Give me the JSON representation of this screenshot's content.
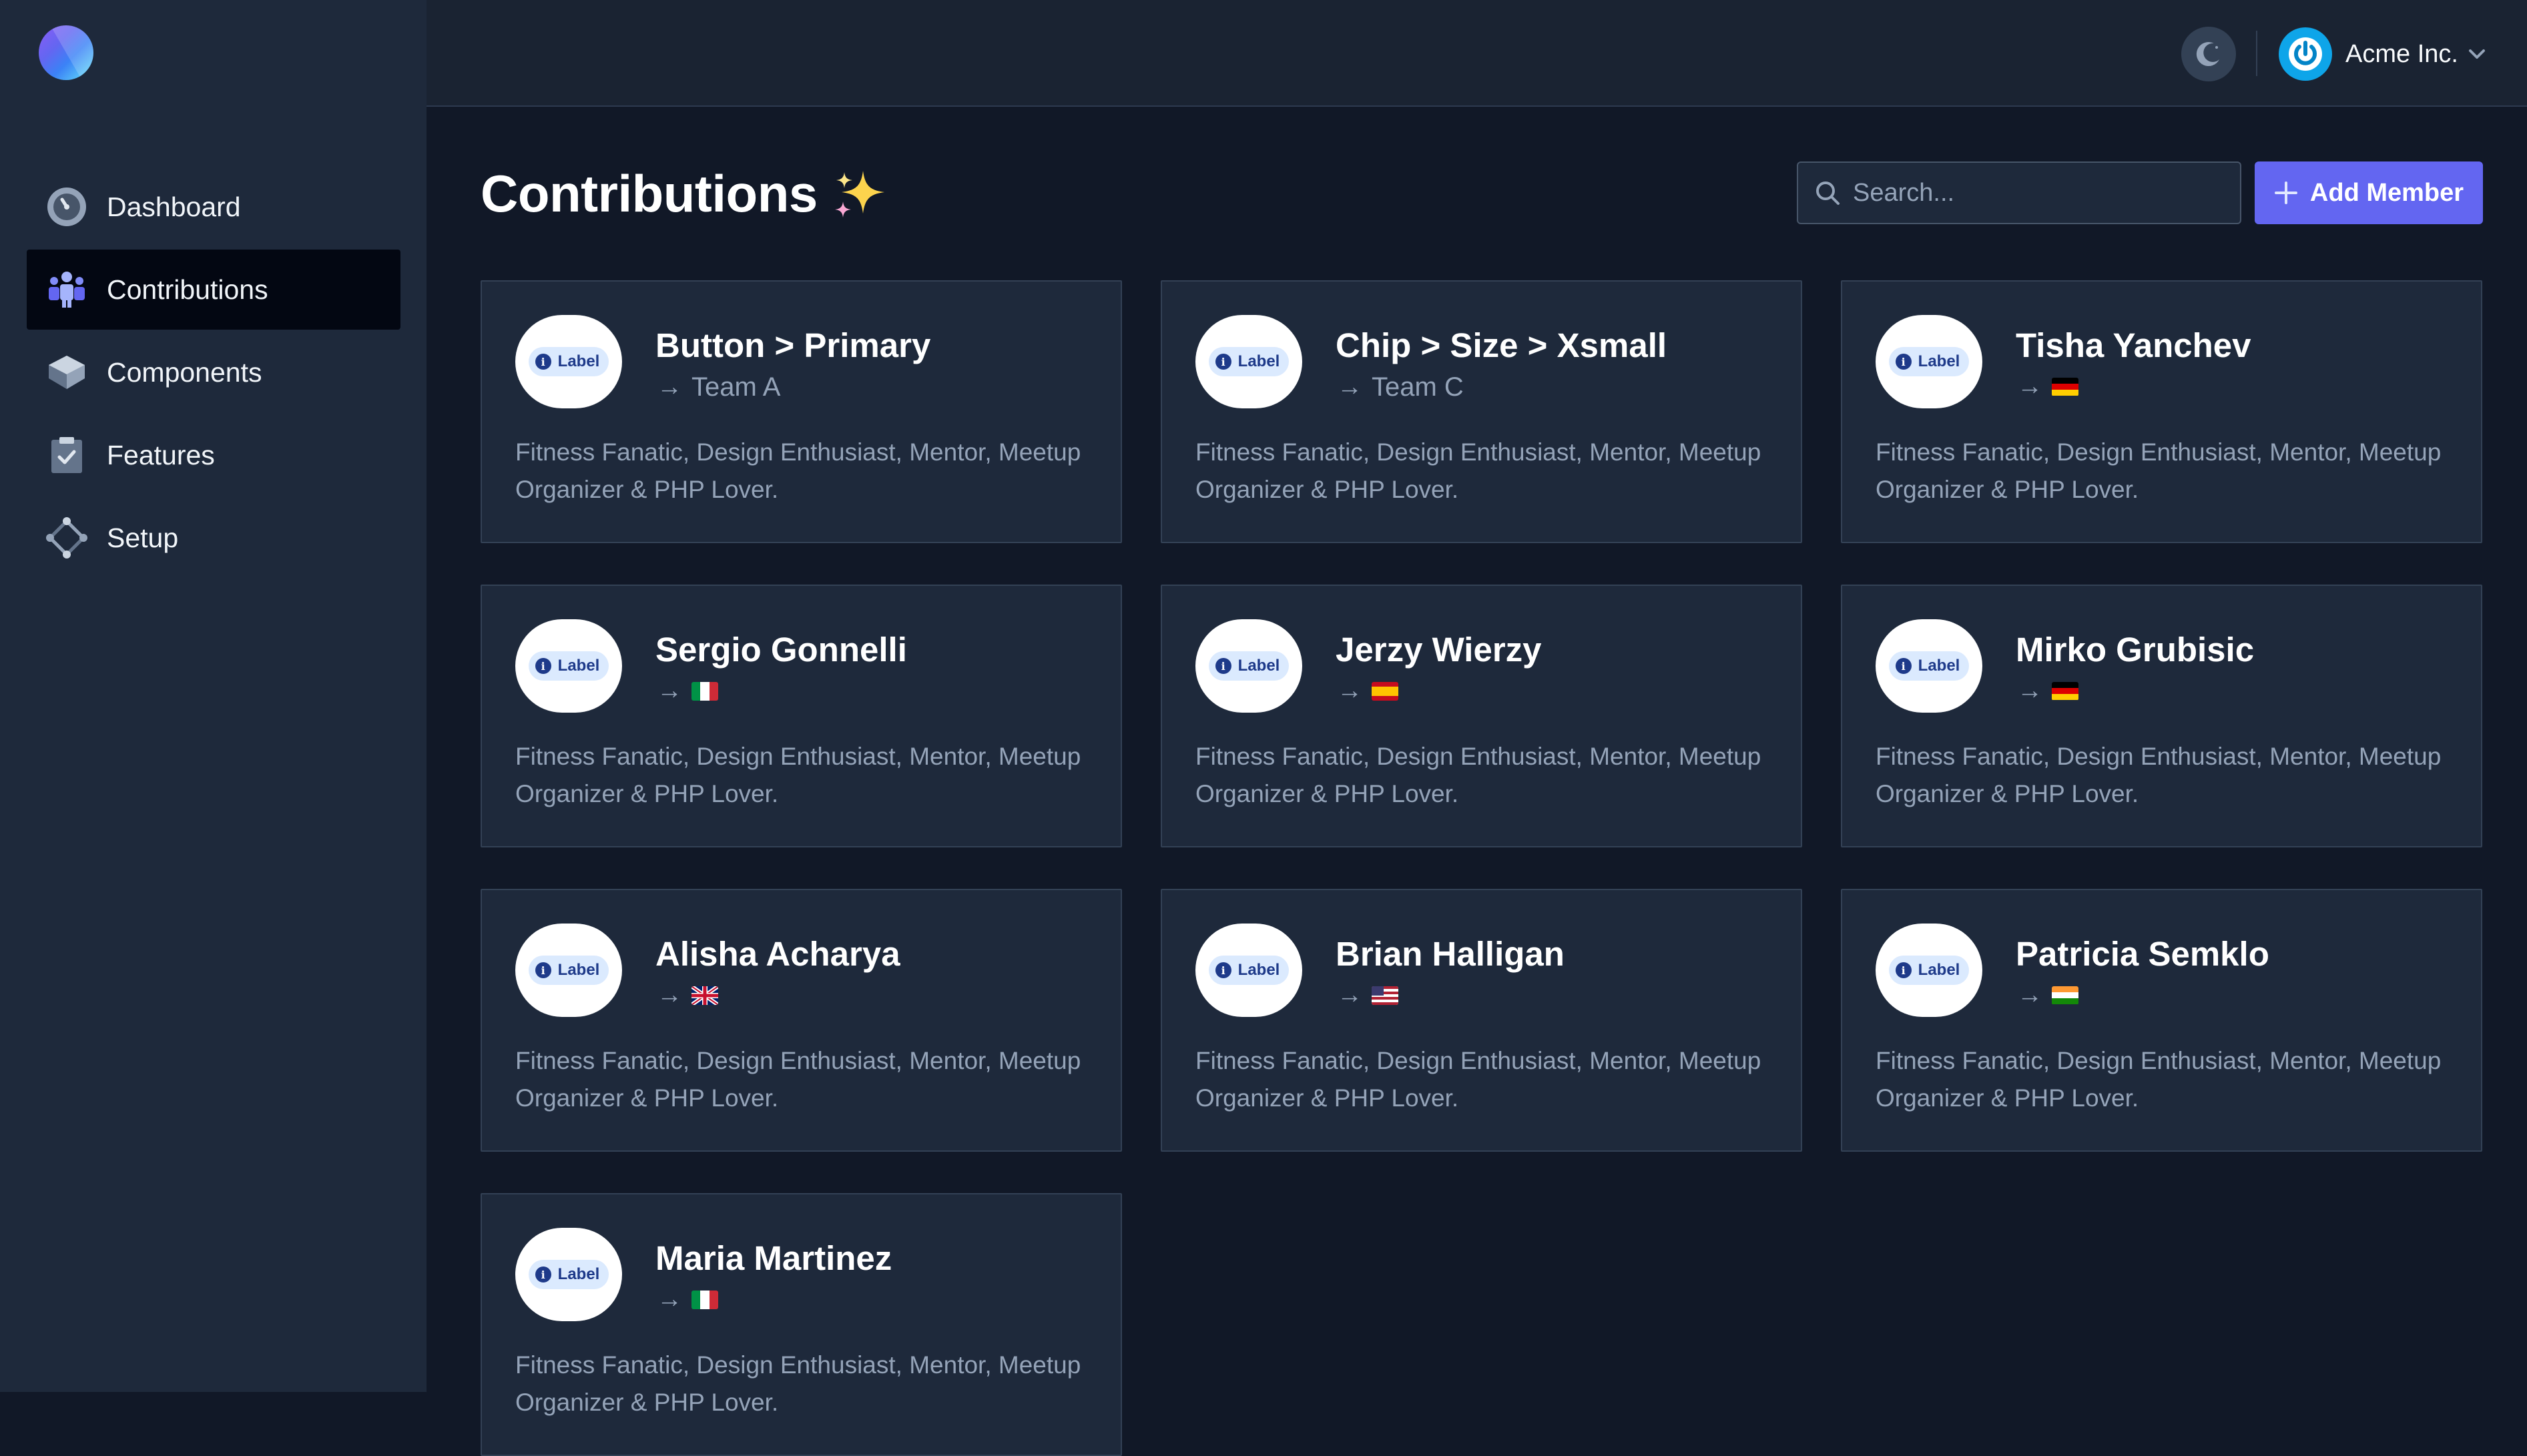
{
  "sidebar": {
    "items": [
      {
        "label": "Dashboard",
        "icon": "dashboard-icon"
      },
      {
        "label": "Contributions",
        "icon": "team-icon",
        "active": true
      },
      {
        "label": "Components",
        "icon": "layers-icon"
      },
      {
        "label": "Features",
        "icon": "clipboard-check-icon"
      },
      {
        "label": "Setup",
        "icon": "setup-icon"
      }
    ]
  },
  "header": {
    "account_name": "Acme Inc."
  },
  "page": {
    "title": "Contributions",
    "search_placeholder": "Search...",
    "add_label": "Add Member"
  },
  "cards": [
    {
      "name": "Button > Primary",
      "sub": "Team A",
      "flag": null,
      "chip": "Label",
      "desc": "Fitness Fanatic, Design Enthusiast, Mentor, Meetup Organizer & PHP Lover."
    },
    {
      "name": "Chip > Size > Xsmall",
      "sub": "Team C",
      "flag": null,
      "chip": "Label",
      "desc": "Fitness Fanatic, Design Enthusiast, Mentor, Meetup Organizer & PHP Lover."
    },
    {
      "name": "Tisha Yanchev",
      "sub": "",
      "flag": "de",
      "chip": "Label",
      "desc": "Fitness Fanatic, Design Enthusiast, Mentor, Meetup Organizer & PHP Lover."
    },
    {
      "name": "Sergio Gonnelli",
      "sub": "",
      "flag": "it",
      "chip": "Label",
      "desc": "Fitness Fanatic, Design Enthusiast, Mentor, Meetup Organizer & PHP Lover."
    },
    {
      "name": "Jerzy Wierzy",
      "sub": "",
      "flag": "es",
      "chip": "Label",
      "desc": "Fitness Fanatic, Design Enthusiast, Mentor, Meetup Organizer & PHP Lover."
    },
    {
      "name": "Mirko Grubisic",
      "sub": "",
      "flag": "de",
      "chip": "Label",
      "desc": "Fitness Fanatic, Design Enthusiast, Mentor, Meetup Organizer & PHP Lover."
    },
    {
      "name": "Alisha Acharya",
      "sub": "",
      "flag": "gb",
      "chip": "Label",
      "desc": "Fitness Fanatic, Design Enthusiast, Mentor, Meetup Organizer & PHP Lover."
    },
    {
      "name": "Brian Halligan",
      "sub": "",
      "flag": "us",
      "chip": "Label",
      "desc": "Fitness Fanatic, Design Enthusiast, Mentor, Meetup Organizer & PHP Lover."
    },
    {
      "name": "Patricia Semklo",
      "sub": "",
      "flag": "in",
      "chip": "Label",
      "desc": "Fitness Fanatic, Design Enthusiast, Mentor, Meetup Organizer & PHP Lover."
    },
    {
      "name": "Maria Martinez",
      "sub": "",
      "flag": "it",
      "chip": "Label",
      "desc": "Fitness Fanatic, Design Enthusiast, Mentor, Meetup Organizer & PHP Lover."
    }
  ],
  "colors": {
    "accent": "#6366f1",
    "sidebar_bg": "#1e293b",
    "main_bg": "#111827",
    "card_bg": "#1e293b"
  }
}
